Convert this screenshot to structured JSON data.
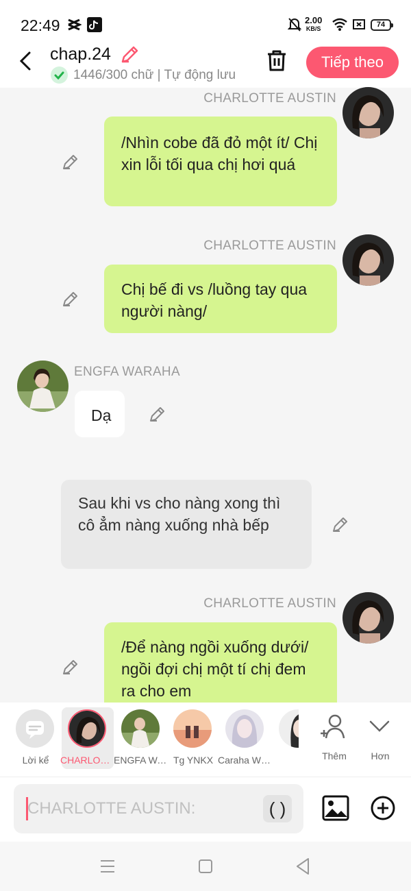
{
  "status_bar": {
    "time": "22:49",
    "speed_value": "2.00",
    "speed_unit": "KB/S",
    "battery": "74"
  },
  "header": {
    "title": "chap.24",
    "word_count": "1446/300 chữ",
    "separator": "|",
    "autosave": "Tự động lưu",
    "next_label": "Tiếp theo"
  },
  "messages": [
    {
      "speaker": "CHARLOTTE AUSTIN",
      "text": "/Nhìn cobe đã đỏ một ít/ Chị xin lỗi tối qua chị hơi quá",
      "side": "right"
    },
    {
      "speaker": "CHARLOTTE AUSTIN",
      "text": "Chị bế đi vs /luồng tay qua người nàng/",
      "side": "right"
    },
    {
      "speaker": "ENGFA WARAHA",
      "text": "Dạ",
      "side": "left"
    },
    {
      "speaker": "",
      "text": "Sau khi vs cho nàng xong thì cô ẳm nàng xuống nhà bếp",
      "side": "narration"
    },
    {
      "speaker": "CHARLOTTE AUSTIN",
      "text": "/Để nàng ngồi xuống dưới/ ngồi đợi chị một tí chị đem ra cho em",
      "side": "right"
    }
  ],
  "characters": [
    {
      "label": "Lời kể"
    },
    {
      "label": "CHARLOTTE AUSTIN"
    },
    {
      "label": "ENGFA WARAHA"
    },
    {
      "label": "Tg YNKX"
    },
    {
      "label": "Caraha Wi...Luna"
    }
  ],
  "char_actions": {
    "more_label": "Thêm",
    "expand_label": "Hơn"
  },
  "composer": {
    "placeholder": "CHARLOTTE AUSTIN:",
    "paren_label": "( )"
  },
  "colors": {
    "accent": "#fc5871",
    "bubble_self": "#d6f590",
    "bubble_other": "#ffffff",
    "narration": "#e9e9e9"
  }
}
